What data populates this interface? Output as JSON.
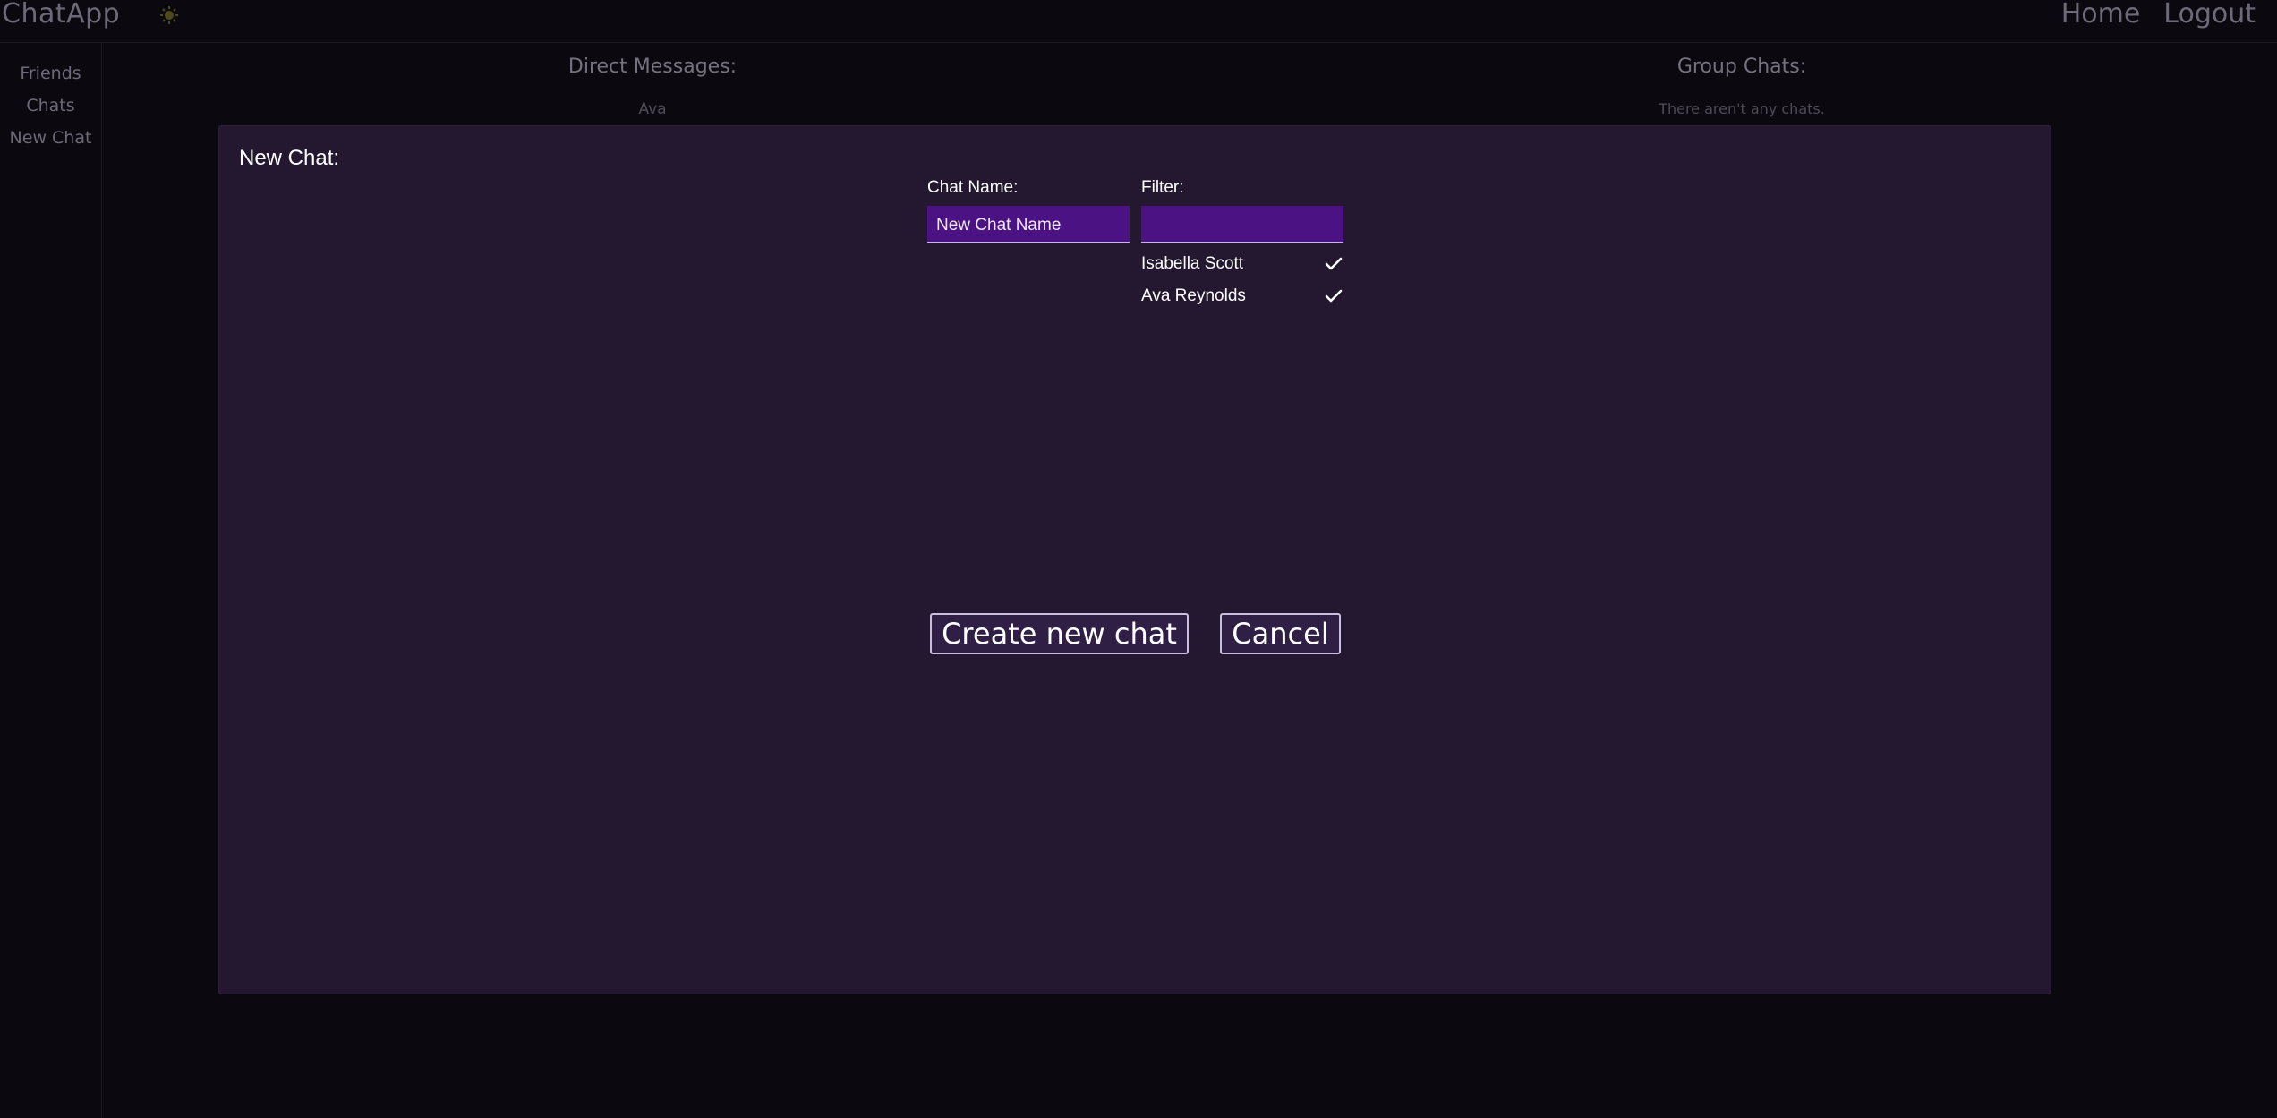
{
  "header": {
    "app_title": "ChatApp",
    "theme_icon": "sun-icon",
    "nav": [
      {
        "label": "Home"
      },
      {
        "label": "Logout"
      }
    ]
  },
  "sidebar": {
    "items": [
      {
        "label": "Friends"
      },
      {
        "label": "Chats"
      },
      {
        "label": "New Chat"
      }
    ]
  },
  "background": {
    "direct_messages": {
      "title": "Direct Messages:",
      "items": [
        "Ava"
      ]
    },
    "group_chats": {
      "title": "Group Chats:",
      "empty_text": "There aren't any chats."
    }
  },
  "modal": {
    "title": "New Chat:",
    "chat_name": {
      "label": "Chat Name:",
      "value": "",
      "placeholder": "New Chat Name"
    },
    "filter": {
      "label": "Filter:",
      "value": "",
      "placeholder": ""
    },
    "friends": [
      {
        "name": "Isabella Scott",
        "selected": true
      },
      {
        "name": "Ava Reynolds",
        "selected": true
      }
    ],
    "create_label": "Create new chat",
    "cancel_label": "Cancel"
  },
  "colors": {
    "page_bg": "#0b090f",
    "modal_bg": "#231830",
    "input_bg": "#4a1283",
    "button_border": "#cbbde0",
    "muted_text": "#6e6978"
  }
}
